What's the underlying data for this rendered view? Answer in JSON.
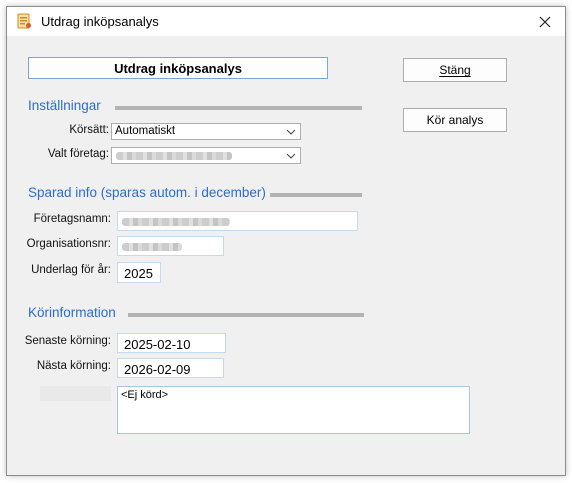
{
  "window": {
    "title": "Utdrag inköpsanalys"
  },
  "header": {
    "title": "Utdrag inköpsanalys"
  },
  "buttons": {
    "close": "Stäng",
    "run": "Kör analys"
  },
  "settings": {
    "title": "Inställningar",
    "run_mode_label": "Körsätt:",
    "run_mode_value": "Automatiskt",
    "company_label": "Valt företag:"
  },
  "saved_info": {
    "title": "Sparad info (sparas autom. i december)",
    "company_name_label": "Företagsnamn:",
    "org_number_label": "Organisationsnr:",
    "basis_year_label": "Underlag för år:",
    "basis_year_value": "2025"
  },
  "run_info": {
    "title": "Körinformation",
    "last_run_label": "Senaste körning:",
    "last_run_value": "2025-02-10",
    "next_run_label": "Nästa körning:",
    "next_run_value": "2026-02-09",
    "notes_value": "<Ej körd>"
  },
  "icons": {
    "app": "app-form-icon",
    "close": "close-icon",
    "dropdown": "chevron-down-icon"
  },
  "colors": {
    "section_title": "#2d6dc9",
    "rule": "#b3b3b3"
  }
}
